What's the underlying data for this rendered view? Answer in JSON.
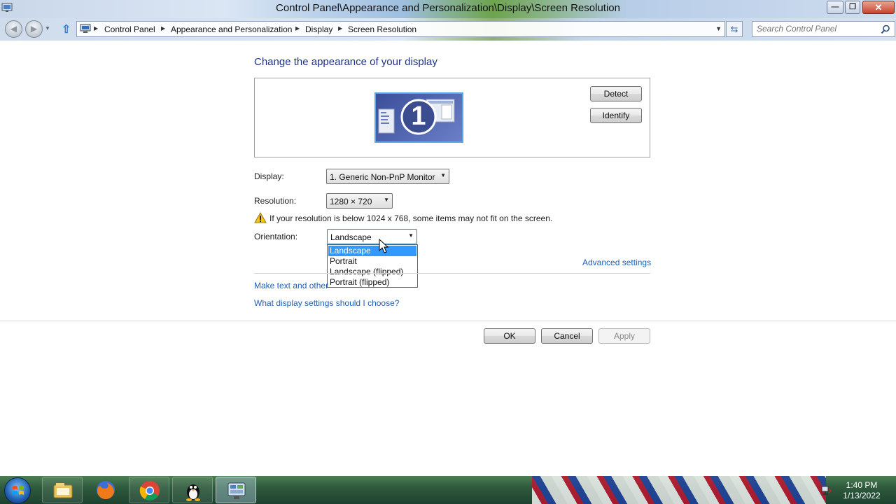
{
  "window": {
    "title": "Control Panel\\Appearance and Personalization\\Display\\Screen Resolution",
    "minimize_glyph": "—",
    "maximize_glyph": "❐",
    "close_glyph": "✕"
  },
  "address_bar": {
    "breadcrumbs": [
      "Control Panel",
      "Appearance and Personalization",
      "Display",
      "Screen Resolution"
    ],
    "search_placeholder": "Search Control Panel"
  },
  "page": {
    "heading": "Change the appearance of your display",
    "monitor_number": "1",
    "detect_label": "Detect",
    "identify_label": "Identify",
    "display_label": "Display:",
    "display_value": "1. Generic Non-PnP Monitor",
    "resolution_label": "Resolution:",
    "resolution_value": "1280 × 720",
    "warning_text": "If your resolution is below 1024 x 768, some items may not fit on the screen.",
    "orientation_label": "Orientation:",
    "orientation_value": "Landscape",
    "orientation_options": [
      "Landscape",
      "Portrait",
      "Landscape (flipped)",
      "Portrait (flipped)"
    ],
    "orientation_selected_index": 0,
    "advanced_link": "Advanced settings",
    "text_size_link": "Make text and other",
    "help_link": "What display settings should I choose?",
    "ok_label": "OK",
    "cancel_label": "Cancel",
    "apply_label": "Apply"
  },
  "taskbar": {
    "items": [
      "explorer-icon",
      "firefox-icon",
      "chrome-icon",
      "linux-tux-icon",
      "control-panel-icon"
    ],
    "time": "1:40 PM",
    "date": "1/13/2022"
  },
  "colors": {
    "heading": "#1e3287",
    "link": "#1f5fb6",
    "selection": "#3399ff"
  }
}
